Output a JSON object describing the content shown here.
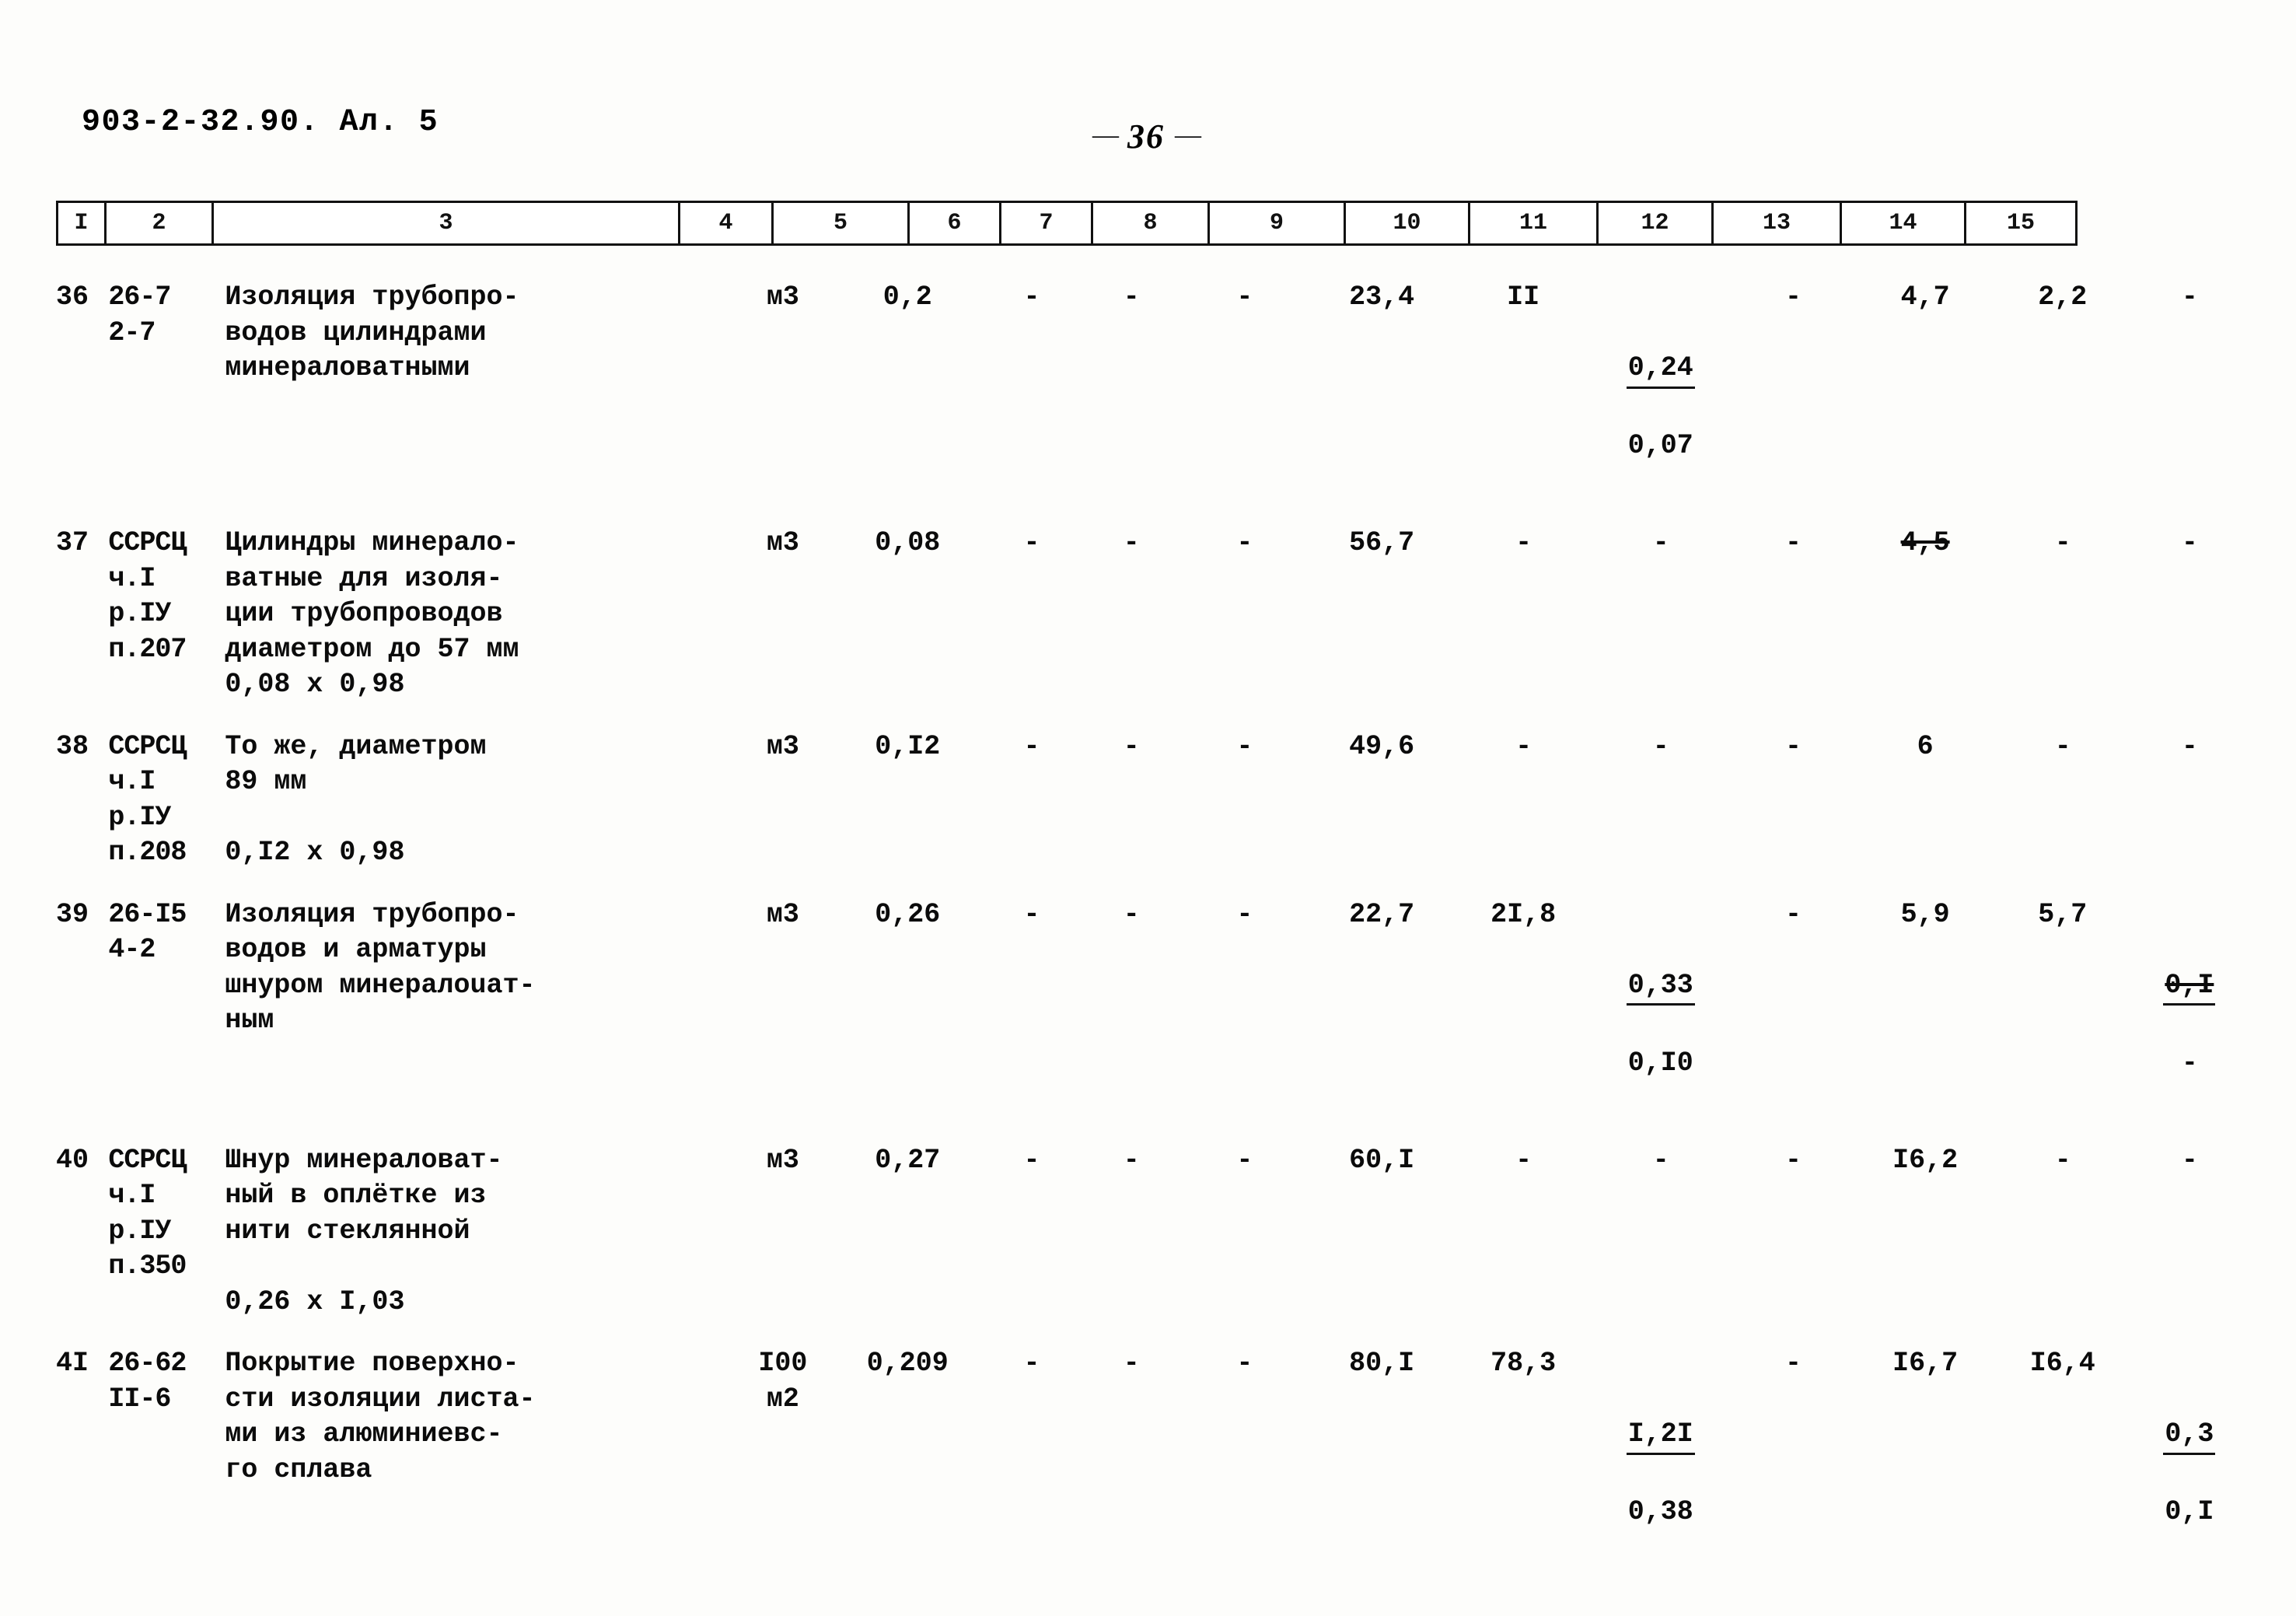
{
  "header": {
    "doc_code": "903-2-32.90. Ал. 5",
    "page_number": "36",
    "dash_left": "—",
    "dash_right": "—"
  },
  "column_headers": [
    "I",
    "2",
    "3",
    "4",
    "5",
    "6",
    "7",
    "8",
    "9",
    "10",
    "11",
    "12",
    "13",
    "14",
    "15"
  ],
  "rows": [
    {
      "num": "36",
      "code": "26-7\n2-7",
      "desc": "Изоляция трубопро-\nводов цилиндрами\nминераловатными",
      "unit": "м3",
      "c5": "0,2",
      "c6": "-",
      "c7": "-",
      "c8": "-",
      "c9": "23,4",
      "c10": "II",
      "c11_top": "0,24",
      "c11_bot": "0,07",
      "c12": "-",
      "c13": "4,7",
      "c14": "2,2",
      "c15": "-"
    },
    {
      "num": "37",
      "code": "ССРСЦ\nч.I\nр.IУ\nп.207",
      "desc": "Цилиндры минерало-\nватные для изоля-\nции трубопроводов\nдиаметром до 57 мм\n0,08 х 0,98",
      "unit": "м3",
      "c5": "0,08",
      "c6": "-",
      "c7": "-",
      "c8": "-",
      "c9": "56,7",
      "c10": "-",
      "c11_top": "-",
      "c11_bot": "",
      "c12": "-",
      "c13": "4,5",
      "c14": "-",
      "c15": "-"
    },
    {
      "num": "38",
      "code": "ССРСЦ\nч.I\nр.IУ\nп.208",
      "desc": "То же, диаметром\n89 мм\n\n0,I2 х 0,98",
      "unit": "м3",
      "c5": "0,I2",
      "c6": "-",
      "c7": "-",
      "c8": "-",
      "c9": "49,6",
      "c10": "-",
      "c11_top": "-",
      "c11_bot": "",
      "c12": "-",
      "c13": "6",
      "c14": "-",
      "c15": "-"
    },
    {
      "num": "39",
      "code": "26-I5\n4-2",
      "desc": "Изоляция трубопро-\nводов и арматуры\nшнуром минералоuат-\nным",
      "unit": "м3",
      "c5": "0,26",
      "c6": "-",
      "c7": "-",
      "c8": "-",
      "c9": "22,7",
      "c10": "2I,8",
      "c11_top": "0,33",
      "c11_bot": "0,I0",
      "c12": "-",
      "c13": "5,9",
      "c14": "5,7",
      "c15_top": "0,I",
      "c15_bot": "-"
    },
    {
      "num": "40",
      "code": "ССРСЦ\nч.I\nр.IУ\nп.350",
      "desc": "Шнур минераловат-\nный в оплётке из\nнити стеклянной\n\n0,26 х I,03",
      "unit": "м3",
      "c5": "0,27",
      "c6": "-",
      "c7": "-",
      "c8": "-",
      "c9": "60,I",
      "c10": "-",
      "c11_top": "-",
      "c11_bot": "",
      "c12": "-",
      "c13": "I6,2",
      "c14": "-",
      "c15": "-"
    },
    {
      "num": "4I",
      "code": "26-62\nII-6",
      "desc": "Покрытие поверхно-\nсти изоляции листа-\nми из алюминиевс-\nго сплава",
      "unit": "I00\nм2",
      "c5": "0,209",
      "c6": "-",
      "c7": "-",
      "c8": "-",
      "c9": "80,I",
      "c10": "78,3",
      "c11_top": "I,2I",
      "c11_bot": "0,38",
      "c12": "-",
      "c13": "I6,7",
      "c14": "I6,4",
      "c15_top": "0,3",
      "c15_bot": "0,I"
    }
  ]
}
